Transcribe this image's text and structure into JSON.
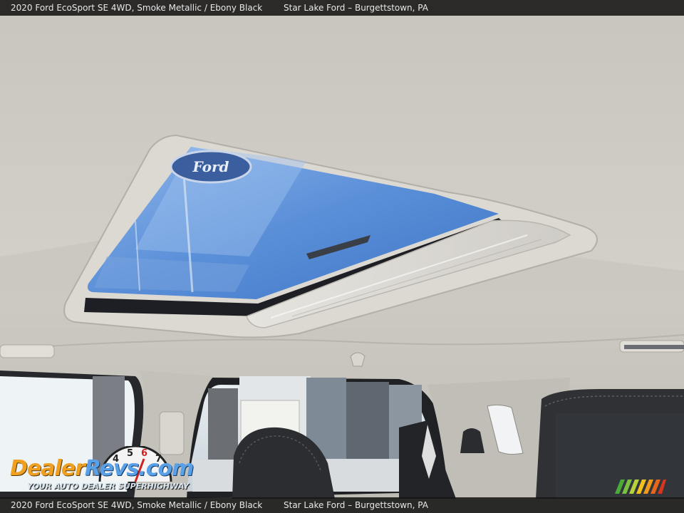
{
  "caption": {
    "vehicle": "2020 Ford EcoSport SE 4WD,  Smoke Metallic / Ebony Black",
    "dealer": "Star Lake Ford – Burgettstown, PA"
  },
  "sunroof": {
    "glass_logo": "Ford"
  },
  "watermark": {
    "brand_part1": "Dealer",
    "brand_part2": "Revs",
    "domain": ".com",
    "tagline": "YOUR AUTO DEALER SUPERHIGHWAY",
    "gauge_numbers": [
      "4",
      "5",
      "6",
      "7"
    ]
  },
  "colors": {
    "headliner": "#cfccc5",
    "sky": "#5a8ed8",
    "caption_bar": "#141414",
    "logo_orange": "#f0a020",
    "logo_blue": "#5aa0e6"
  }
}
